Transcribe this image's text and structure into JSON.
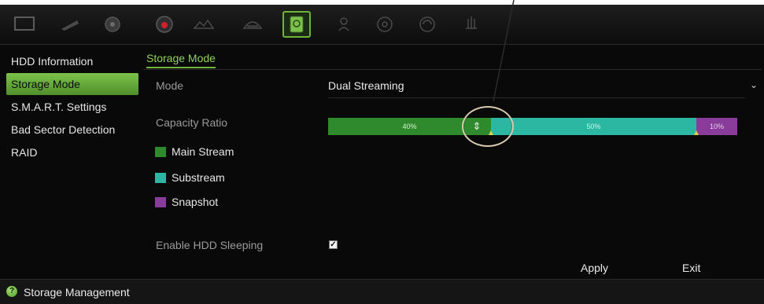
{
  "toolbar": {
    "icons": [
      "monitor-icon",
      "camera-icon",
      "network-icon",
      "record-icon",
      "alarm-icon",
      "device-icon",
      "hdd-icon",
      "user-icon",
      "system-icon",
      "maintenance-icon",
      "shutdown-icon"
    ],
    "active": "hdd-icon"
  },
  "sidebar": {
    "items": [
      {
        "label": "HDD Information"
      },
      {
        "label": "Storage Mode"
      },
      {
        "label": "S.M.A.R.T. Settings"
      },
      {
        "label": "Bad Sector Detection"
      },
      {
        "label": "RAID"
      }
    ],
    "active_index": 1
  },
  "main": {
    "tab": "Storage Mode",
    "mode_label": "Mode",
    "mode_value": "Dual Streaming",
    "capacity_label": "Capacity Ratio",
    "ratio": {
      "main_stream": "40%",
      "substream": "50%",
      "snapshot": "10%"
    },
    "legend": [
      {
        "label": "Main Stream",
        "color": "#2f8a2e"
      },
      {
        "label": "Substream",
        "color": "#2bb7a1"
      },
      {
        "label": "Snapshot",
        "color": "#8a3c9a"
      }
    ],
    "sleep_label": "Enable HDD Sleeping",
    "sleep_checked": true,
    "apply_label": "Apply",
    "exit_label": "Exit"
  },
  "statusbar": {
    "icon": "help-icon",
    "text": "Storage Management"
  },
  "colors": {
    "accent": "#6fb33a",
    "background": "#090909"
  }
}
